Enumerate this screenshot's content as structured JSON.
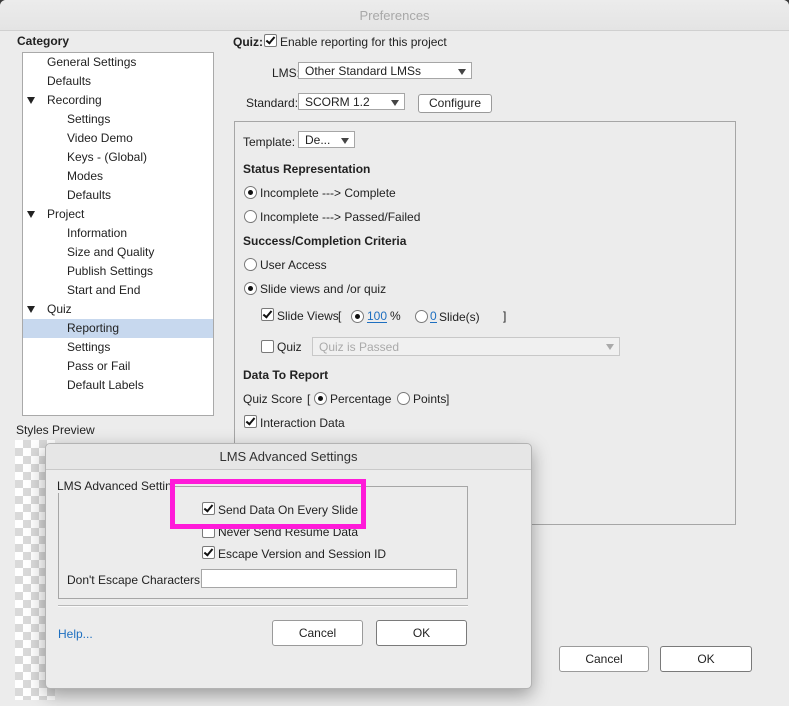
{
  "prefs": {
    "title": "Preferences",
    "category_label": "Category",
    "tree": [
      {
        "label": "General Settings",
        "level": 1
      },
      {
        "label": "Defaults",
        "level": 1
      },
      {
        "label": "Recording",
        "level": 1,
        "expanded": true
      },
      {
        "label": "Settings",
        "level": 2
      },
      {
        "label": "Video Demo",
        "level": 2
      },
      {
        "label": "Keys - (Global)",
        "level": 2
      },
      {
        "label": "Modes",
        "level": 2
      },
      {
        "label": "Defaults",
        "level": 2
      },
      {
        "label": "Project",
        "level": 1,
        "expanded": true
      },
      {
        "label": "Information",
        "level": 2
      },
      {
        "label": "Size and Quality",
        "level": 2
      },
      {
        "label": "Publish Settings",
        "level": 2
      },
      {
        "label": "Start and End",
        "level": 2
      },
      {
        "label": "Quiz",
        "level": 1,
        "expanded": true
      },
      {
        "label": "Reporting",
        "level": 2,
        "selected": true
      },
      {
        "label": "Settings",
        "level": 2
      },
      {
        "label": "Pass or Fail",
        "level": 2
      },
      {
        "label": "Default Labels",
        "level": 2
      }
    ],
    "styles_preview_label": "Styles Preview",
    "quiz_label": "Quiz:",
    "enable_reporting_label": "Enable reporting for this project",
    "enable_reporting_checked": true,
    "lms_label": "LMS:",
    "lms_value": "Other Standard LMSs",
    "standard_label": "Standard:",
    "standard_value": "SCORM 1.2",
    "configure_label": "Configure",
    "template_label": "Template:",
    "template_value": "De...",
    "status_heading": "Status Representation",
    "status_options": [
      "Incomplete ---> Complete",
      "Incomplete ---> Passed/Failed"
    ],
    "status_selected": 0,
    "criteria_heading": "Success/Completion Criteria",
    "criteria_options": [
      "User Access",
      "Slide views and /or quiz"
    ],
    "criteria_selected": 1,
    "slide_views_label": "Slide Views",
    "bracket_open": "[",
    "bracket_close": "]",
    "slide_views_percent_value": "100",
    "percent_sign": "%",
    "slide_views_count_value": "0",
    "slides_label": "Slide(s)",
    "quiz_check_label": "Quiz",
    "quiz_select_value": "Quiz is Passed",
    "data_heading": "Data To Report",
    "quiz_score_label": "Quiz Score",
    "quiz_score_open": "[",
    "percentage_label": "Percentage",
    "points_label": "Points",
    "points_close": "]",
    "interaction_data_label": "Interaction Data",
    "cancel_label": "Cancel",
    "ok_label": "OK"
  },
  "lms_dialog": {
    "title": "LMS Advanced Settings",
    "group_label": "LMS Advanced Settin",
    "send_data_label": "Send Data On Every Slide",
    "send_data_checked": true,
    "never_send_label": "Never Send Resume Data",
    "never_send_checked": false,
    "escape_label": "Escape Version and Session ID",
    "escape_checked": true,
    "dont_escape_label": "Don't Escape Characters:",
    "dont_escape_value": "",
    "help_label": "Help...",
    "cancel_label": "Cancel",
    "ok_label": "OK"
  },
  "colors": {
    "highlight": "#ff1ad9",
    "selection": "#c7d8ee",
    "link": "#1e6fc0"
  }
}
